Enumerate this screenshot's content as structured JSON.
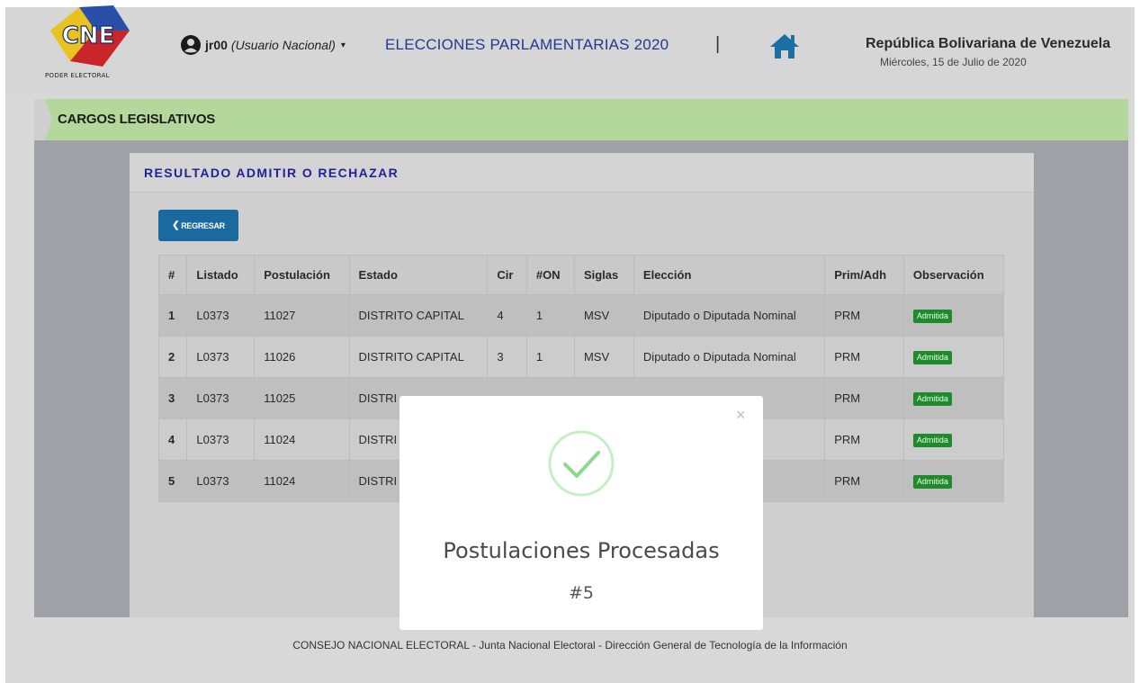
{
  "header": {
    "logo_text": "CNE",
    "logo_caption": "PODER ELECTORAL",
    "user_name": "jr00",
    "user_role": "(Usuario Nacional)",
    "user_caret": "▾",
    "election_title": "ELECCIONES PARLAMENTARIAS 2020",
    "separator": "|",
    "home_icon": "home-icon",
    "country": "República Bolivariana de Venezuela",
    "date": "Miércoles, 15 de Julio de 2020"
  },
  "section": {
    "title": "CARGOS LEGISLATIVOS"
  },
  "panel": {
    "title": "RESULTADO ADMITIR O RECHAZAR",
    "back_chevron": "❮",
    "back_label": "REGRESAR"
  },
  "table": {
    "headers": [
      "#",
      "Listado",
      "Postulación",
      "Estado",
      "Cir",
      "#ON",
      "Siglas",
      "Elección",
      "Prim/Adh",
      "Observación"
    ],
    "rows": [
      [
        "1",
        "L0373",
        "11027",
        "DISTRITO CAPITAL",
        "4",
        "1",
        "MSV",
        "Diputado o Diputada Nominal",
        "PRM",
        "Admitida"
      ],
      [
        "2",
        "L0373",
        "11026",
        "DISTRITO CAPITAL",
        "3",
        "1",
        "MSV",
        "Diputado o Diputada Nominal",
        "PRM",
        "Admitida"
      ],
      [
        "3",
        "L0373",
        "11025",
        "DISTRI",
        "",
        "",
        "",
        "",
        "PRM",
        "Admitida"
      ],
      [
        "4",
        "L0373",
        "11024",
        "DISTRI",
        "",
        "",
        "",
        "",
        "PRM",
        "Admitida"
      ],
      [
        "5",
        "L0373",
        "11024",
        "DISTRI",
        "",
        "",
        "",
        "",
        "PRM",
        "Admitida"
      ]
    ]
  },
  "footer": {
    "text": "CONSEJO NACIONAL ELECTORAL - Junta Nacional Electoral - Dirección General de Tecnología de la Información"
  },
  "modal": {
    "close": "×",
    "title": "Postulaciones Procesadas",
    "count": "#5"
  },
  "colors": {
    "green_bar": "#b4d89c",
    "accent_blue": "#1f3a93",
    "badge_green": "#1e8a2b",
    "button_blue": "#1a6aa0",
    "success_green": "#8fd88f"
  }
}
